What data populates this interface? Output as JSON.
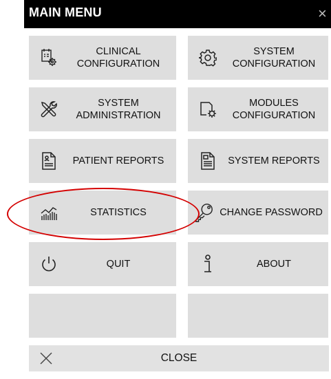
{
  "header": {
    "title": "MAIN MENU",
    "close_glyph": "×"
  },
  "menu": [
    {
      "id": "clinical-configuration",
      "label": "CLINICAL\nCONFIGURATION",
      "icon": "clinical-config-icon"
    },
    {
      "id": "system-configuration",
      "label": "SYSTEM\nCONFIGURATION",
      "icon": "gear-icon"
    },
    {
      "id": "system-administration",
      "label": "SYSTEM\nADMINISTRATION",
      "icon": "tools-icon"
    },
    {
      "id": "modules-configuration",
      "label": "MODULES\nCONFIGURATION",
      "icon": "module-config-icon"
    },
    {
      "id": "patient-reports",
      "label": "PATIENT REPORTS",
      "icon": "patient-report-icon"
    },
    {
      "id": "system-reports",
      "label": "SYSTEM REPORTS",
      "icon": "system-report-icon"
    },
    {
      "id": "statistics",
      "label": "STATISTICS",
      "icon": "statistics-icon"
    },
    {
      "id": "change-password",
      "label": "CHANGE PASSWORD",
      "icon": "key-icon"
    },
    {
      "id": "quit",
      "label": "QUIT",
      "icon": "power-icon"
    },
    {
      "id": "about",
      "label": "ABOUT",
      "icon": "info-icon"
    },
    {
      "id": "empty-left",
      "label": "",
      "icon": ""
    },
    {
      "id": "empty-right",
      "label": "",
      "icon": ""
    }
  ],
  "footer": {
    "close_label": "CLOSE",
    "close_icon": "close-icon"
  },
  "colors": {
    "header_bg": "#000000",
    "tile_bg": "#dedede",
    "annotation": "#d40000"
  }
}
